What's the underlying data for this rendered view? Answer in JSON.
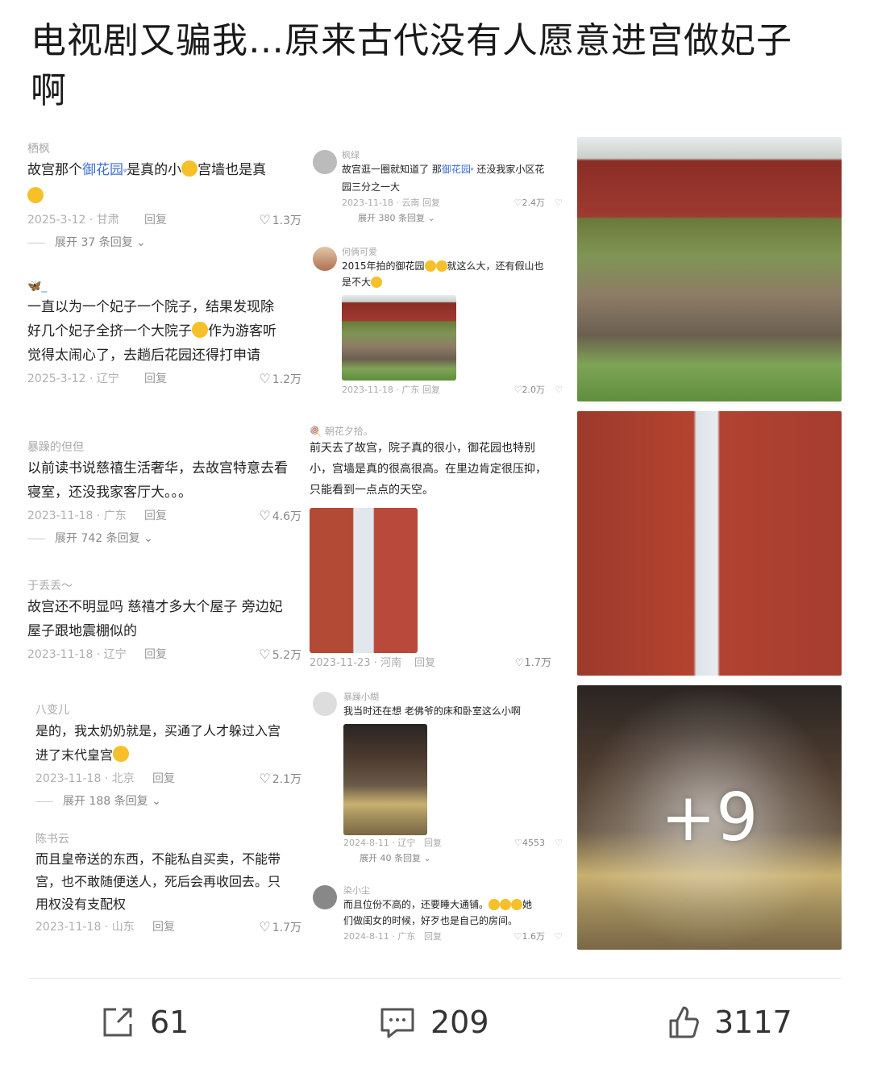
{
  "post": {
    "title_line1": "电视剧又骗我…原来古代没有人愿意进宫做妃子",
    "title_line2": "啊"
  },
  "col1": {
    "comments": [
      {
        "user": "栖枫",
        "lines": [
          "故宫那个",
          "御花园",
          "是真的小",
          "宫墙也是真"
        ],
        "date": "2025-3-12 · 甘肃",
        "reply": "回复",
        "likes": "1.3万",
        "expand": "展开 37 条回复"
      },
      {
        "user": "🦋_",
        "line1": "一直以为一个妃子一个院子，结果发现除",
        "line2": "好几个妃子全挤一个大院子",
        "line2b": "作为游客听",
        "line3": "觉得太闹心了，去趟后花园还得打申请",
        "date": "2025-3-12 · 辽宁",
        "reply": "回复",
        "likes": "1.2万"
      },
      {
        "user": "暴躁的但但",
        "line1": "以前读书说慈禧生活奢华，去故宫特意去看",
        "line2": "寝室，还没我家客厅大。。。",
        "date": "2023-11-18 · 广东",
        "reply": "回复",
        "likes": "4.6万",
        "expand": "展开 742 条回复"
      },
      {
        "user": "于丢丢～",
        "line1": "故宫还不明显吗 慈禧才多大个屋子 旁边妃",
        "line2": "屋子跟地震棚似的",
        "date": "2023-11-18 · 辽宁",
        "reply": "回复",
        "likes": "5.2万"
      },
      {
        "user": "八变儿",
        "line1": "是的，我太奶奶就是，买通了人才躲过入宫",
        "line2": "进了末代皇宫",
        "date": "2023-11-18 · 北京",
        "reply": "回复",
        "likes": "2.1万",
        "expand": "展开 188 条回复"
      },
      {
        "user": "陈书云",
        "line1": "而且皇帝送的东西，不能私自买卖，不能带",
        "line2": "宫，也不敢随便送人，死后会再收回去。只",
        "line3": "用权没有支配权",
        "date": "2023-11-18 · 山东",
        "reply": "回复",
        "likes": "1.7万"
      }
    ]
  },
  "col2": {
    "c1": {
      "user": "枫绿",
      "text_a": "故宫逛一圈就知道了 那",
      "text_hl": "御花园",
      "text_b": " 还没我家小区花",
      "text_c": "园三分之一大",
      "date": "2023-11-18 · 云南",
      "reply": "回复",
      "likes": "2.4万",
      "expand": "展开 380 条回复"
    },
    "c2": {
      "user": "何俩可爱",
      "text_a": "2015年拍的御花园",
      "text_b": "就这么大，还有假山也",
      "text_c": "是不大",
      "date": "2023-11-18 · 广东",
      "reply": "回复",
      "likes": "2.0万"
    },
    "c3": {
      "user": "朝花夕拾。",
      "line1": "前天去了故宫，院子真的很小，御花园也特别",
      "line2": "小，宫墙是真的很高很高。在里边肯定很压抑，",
      "line3": "只能看到一点点的天空。",
      "date": "2023-11-23 · 河南",
      "reply": "回复",
      "likes": "1.7万"
    },
    "c4": {
      "user": "暴躁小糊",
      "text": "我当时还在想 老佛爷的床和卧室这么小啊",
      "date": "2024-8-11 · 辽宁",
      "reply": "回复",
      "likes": "4553",
      "expand": "展开 40 条回复"
    },
    "c5": {
      "user": "染小尘",
      "line1": "而且位份不高的，还要睡大通铺。",
      "line1b": "她",
      "line2": "们做闺女的时候，好歹也是自己的房间。",
      "date": "2024-8-11 · 广东",
      "reply": "回复",
      "likes": "1.6万"
    }
  },
  "photos": {
    "more_count": "+9"
  },
  "actions": {
    "share_count": "61",
    "comment_count": "209",
    "like_count": "3117"
  }
}
